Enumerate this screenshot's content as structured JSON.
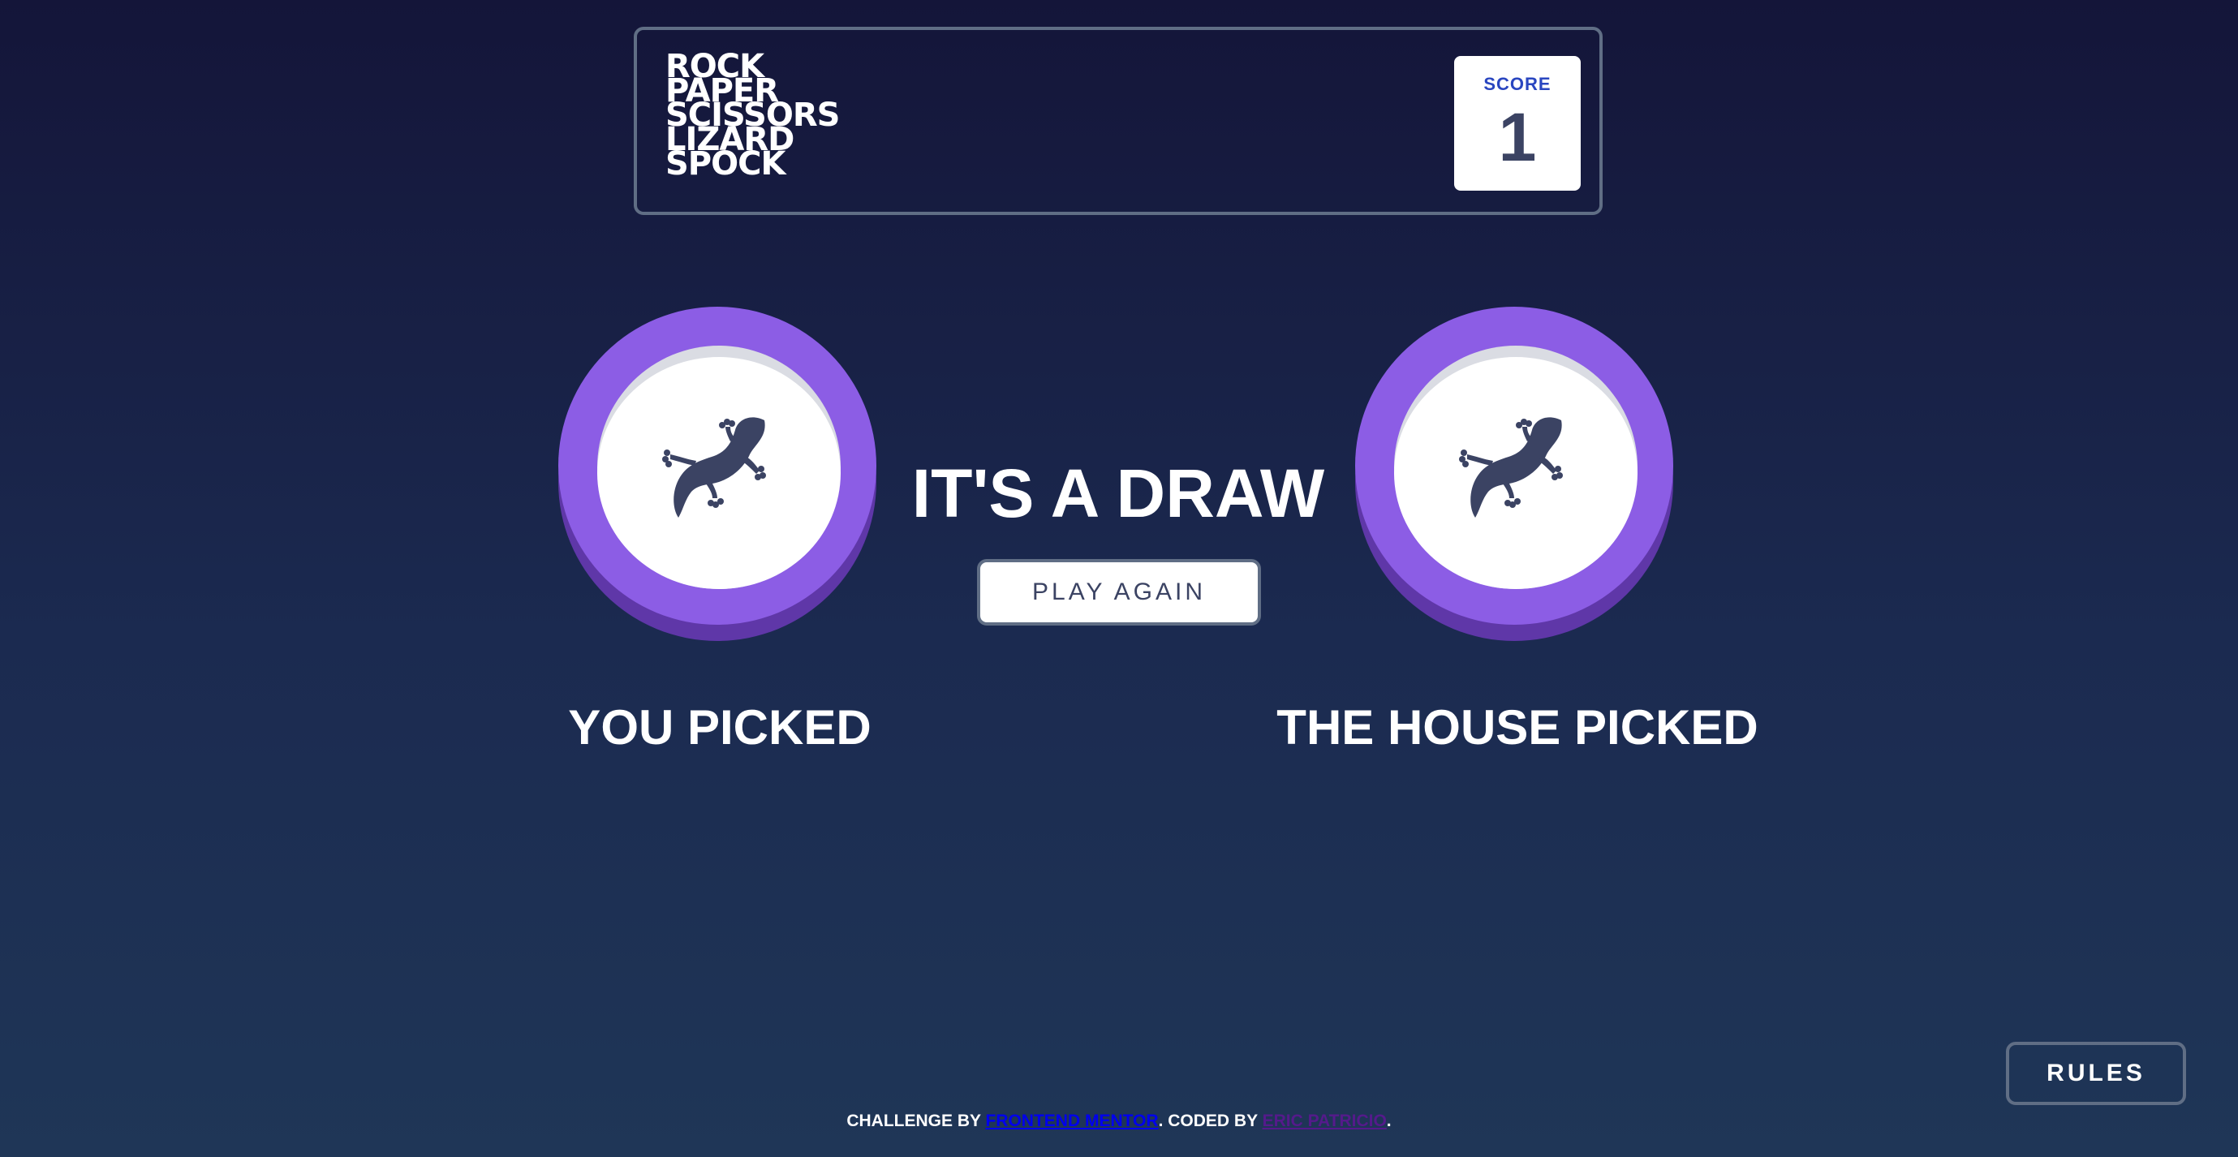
{
  "header": {
    "logo_lines": [
      "ROCK",
      "PAPER",
      "SCISSORS",
      "LIZARD",
      "SPOCK"
    ],
    "score_label": "SCORE",
    "score_value": "1"
  },
  "game": {
    "player_pick_label": "YOU PICKED",
    "house_pick_label": "THE HOUSE PICKED",
    "player_choice_icon": "lizard-icon",
    "house_choice_icon": "lizard-icon",
    "result_text": "IT'S A DRAW",
    "play_again_label": "PLAY AGAIN"
  },
  "rules_label": "RULES",
  "footer": {
    "prefix": "CHALLENGE BY ",
    "frontend_mentor_link": "FRONTEND MENTOR",
    "middle": ". CODED BY ",
    "author_link": "ERIC PATRICIO",
    "suffix": "."
  },
  "colors": {
    "lizard_ring": "#8c5de5",
    "lizard_ring_shadow": "#5f37a8",
    "header_border": "#606e85",
    "score_label": "#2a46c0",
    "dark_text": "#3b4363"
  }
}
